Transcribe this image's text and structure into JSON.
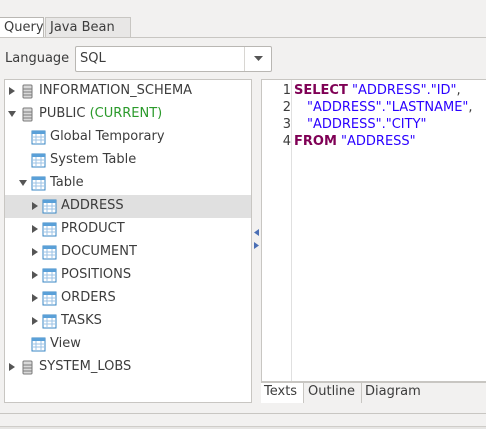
{
  "tabs": {
    "query": "Query",
    "java_bean": "Java Bean"
  },
  "language": {
    "label": "Language",
    "value": "SQL"
  },
  "tree": {
    "information_schema": "INFORMATION_SCHEMA",
    "public": "PUBLIC",
    "public_current": "(CURRENT)",
    "global_temporary": "Global Temporary",
    "system_table": "System Table",
    "table": "Table",
    "address": "ADDRESS",
    "product": "PRODUCT",
    "document": "DOCUMENT",
    "positions": "POSITIONS",
    "orders": "ORDERS",
    "tasks": "TASKS",
    "view": "View",
    "system_lobs": "SYSTEM_LOBS"
  },
  "editor": {
    "line_numbers": [
      "1",
      "2",
      "3",
      "4"
    ],
    "kw_select": "SELECT",
    "l1_str": "\"ADDRESS\".\"ID\"",
    "l1_comma": ",",
    "l2_str": "\"ADDRESS\".\"LASTNAME\"",
    "l2_comma": ",",
    "l3_str": "\"ADDRESS\".\"CITY\"",
    "kw_from": "FROM",
    "l4_str": "\"ADDRESS\""
  },
  "editor_tabs": {
    "texts": "Texts",
    "outline": "Outline",
    "diagram": "Diagram"
  },
  "colors": {
    "keyword": "#7f0055",
    "string": "#2a00ff",
    "current": "#2b9a2b",
    "selection": "#e0e0e0"
  },
  "icons": [
    "database-icon",
    "table-folder-icon",
    "table-icon",
    "view-icon",
    "expand-arrow-icon",
    "collapse-arrow-icon",
    "dropdown-arrow-icon"
  ]
}
